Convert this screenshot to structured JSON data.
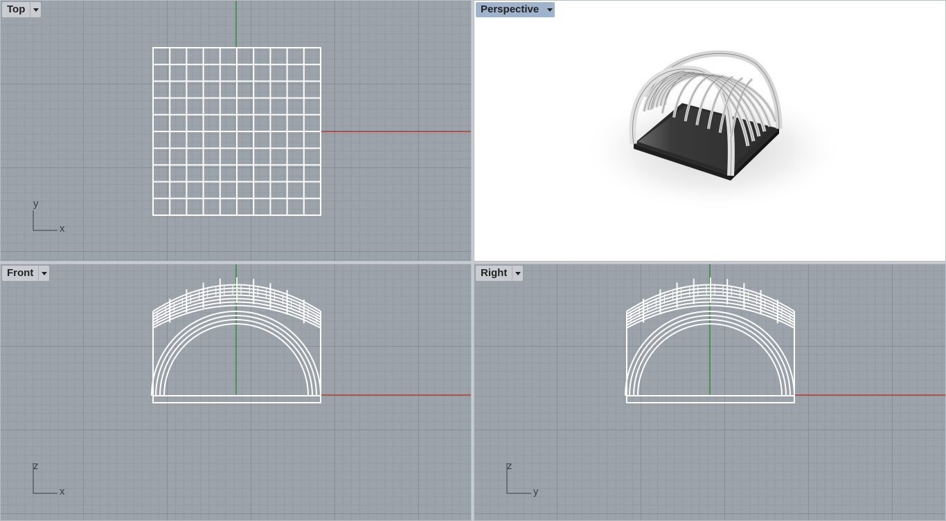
{
  "viewports": {
    "top": {
      "label": "Top",
      "axis_h": "x",
      "axis_v": "y"
    },
    "perspective": {
      "label": "Perspective"
    },
    "front": {
      "label": "Front",
      "axis_h": "x",
      "axis_v": "z"
    },
    "right": {
      "label": "Right",
      "axis_h": "y",
      "axis_v": "z"
    }
  },
  "active_viewport": "perspective",
  "colors": {
    "grid_bg": "#9da3ab",
    "x_axis": "#b03a2e",
    "y_axis": "#2e8b35",
    "active_tab": "#9fb3cc",
    "wireframe": "#ffffff"
  },
  "icons": {
    "viewport_menu": "chevron-down-icon"
  }
}
